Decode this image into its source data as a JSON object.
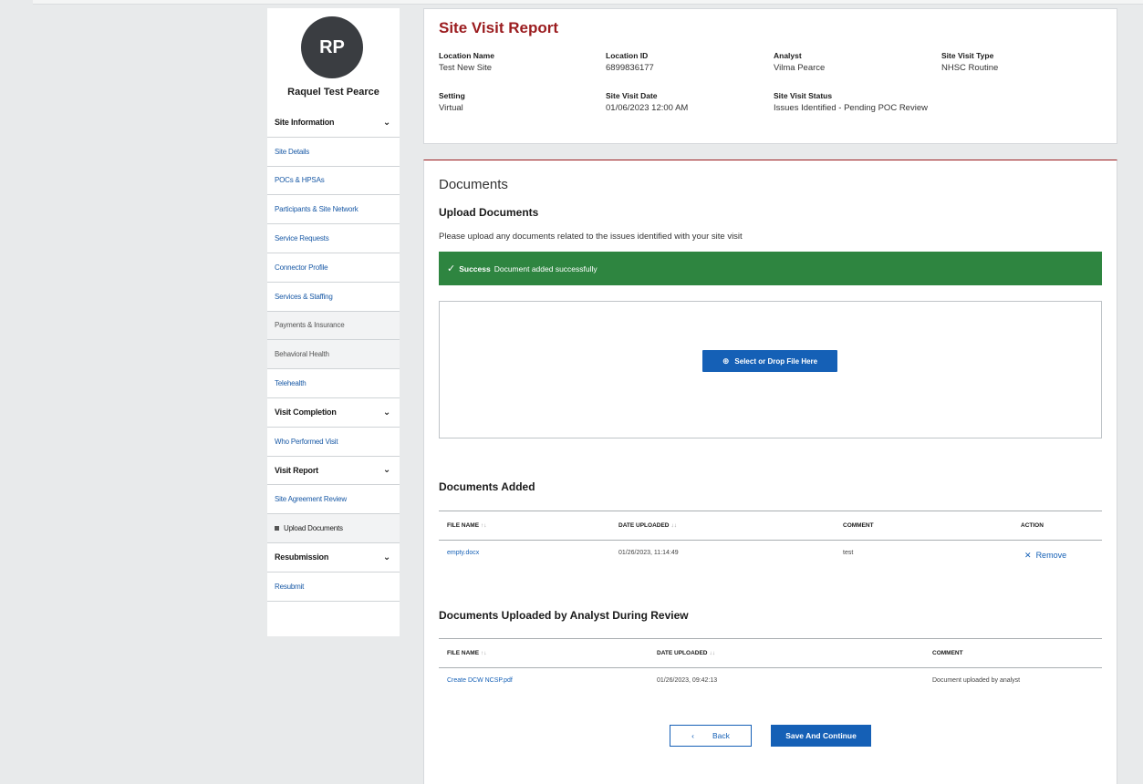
{
  "user": {
    "initials": "RP",
    "name": "Raquel Test Pearce"
  },
  "sidebar": {
    "items": [
      {
        "label": "Site Information",
        "type": "section"
      },
      {
        "label": "Site Details",
        "type": "link"
      },
      {
        "label": "POCs & HPSAs",
        "type": "link"
      },
      {
        "label": "Participants & Site Network",
        "type": "link"
      },
      {
        "label": "Service Requests",
        "type": "link"
      },
      {
        "label": "Connector Profile",
        "type": "link"
      },
      {
        "label": "Services & Staffing",
        "type": "link"
      },
      {
        "label": "Payments & Insurance",
        "type": "disabled"
      },
      {
        "label": "Behavioral Health",
        "type": "disabled"
      },
      {
        "label": "Telehealth",
        "type": "link"
      },
      {
        "label": "Visit Completion",
        "type": "section"
      },
      {
        "label": "Who Performed Visit",
        "type": "link"
      },
      {
        "label": "Visit Report",
        "type": "section"
      },
      {
        "label": "Site Agreement Review",
        "type": "link"
      },
      {
        "label": "Upload Documents",
        "type": "current"
      },
      {
        "label": "Resubmission",
        "type": "section"
      },
      {
        "label": "Resubmit",
        "type": "link"
      }
    ]
  },
  "report": {
    "title": "Site Visit Report",
    "fields": {
      "location_name": {
        "label": "Location Name",
        "value": "Test New Site"
      },
      "location_id": {
        "label": "Location ID",
        "value": "6899836177"
      },
      "analyst": {
        "label": "Analyst",
        "value": "Vilma Pearce"
      },
      "visit_type": {
        "label": "Site Visit Type",
        "value": "NHSC Routine"
      },
      "setting": {
        "label": "Setting",
        "value": "Virtual"
      },
      "visit_date": {
        "label": "Site Visit Date",
        "value": "01/06/2023 12:00 AM"
      },
      "visit_status": {
        "label": "Site Visit Status",
        "value": "Issues Identified - Pending POC Review"
      }
    }
  },
  "documents": {
    "title": "Documents",
    "upload_title": "Upload Documents",
    "upload_desc": "Please upload any documents related to the issues identified with your site visit",
    "alert": {
      "strong": "Success",
      "text": "Document added successfully",
      "color": "#2e8540"
    },
    "select_btn": "Select or Drop File Here",
    "added": {
      "title": "Documents Added",
      "headers": {
        "file": "FILE NAME",
        "date": "DATE UPLOADED",
        "comment": "COMMENT",
        "action": "ACTION"
      },
      "rows": [
        {
          "file": "empty.docx",
          "date": "01/26/2023, 11:14:49",
          "comment": "test",
          "action": "Remove"
        }
      ]
    },
    "analyst": {
      "title": "Documents Uploaded by Analyst During Review",
      "headers": {
        "file": "FILE NAME",
        "date": "DATE UPLOADED",
        "comment": "COMMENT"
      },
      "rows": [
        {
          "file": "Create DCW NCSP.pdf",
          "date": "01/26/2023, 09:42:13",
          "comment": "Document uploaded by analyst"
        }
      ]
    }
  },
  "buttons": {
    "back": "Back",
    "save": "Save And Continue"
  },
  "colors": {
    "brand_red": "#9b1c1f",
    "primary_blue": "#1560b6",
    "success_green": "#2e8540"
  }
}
